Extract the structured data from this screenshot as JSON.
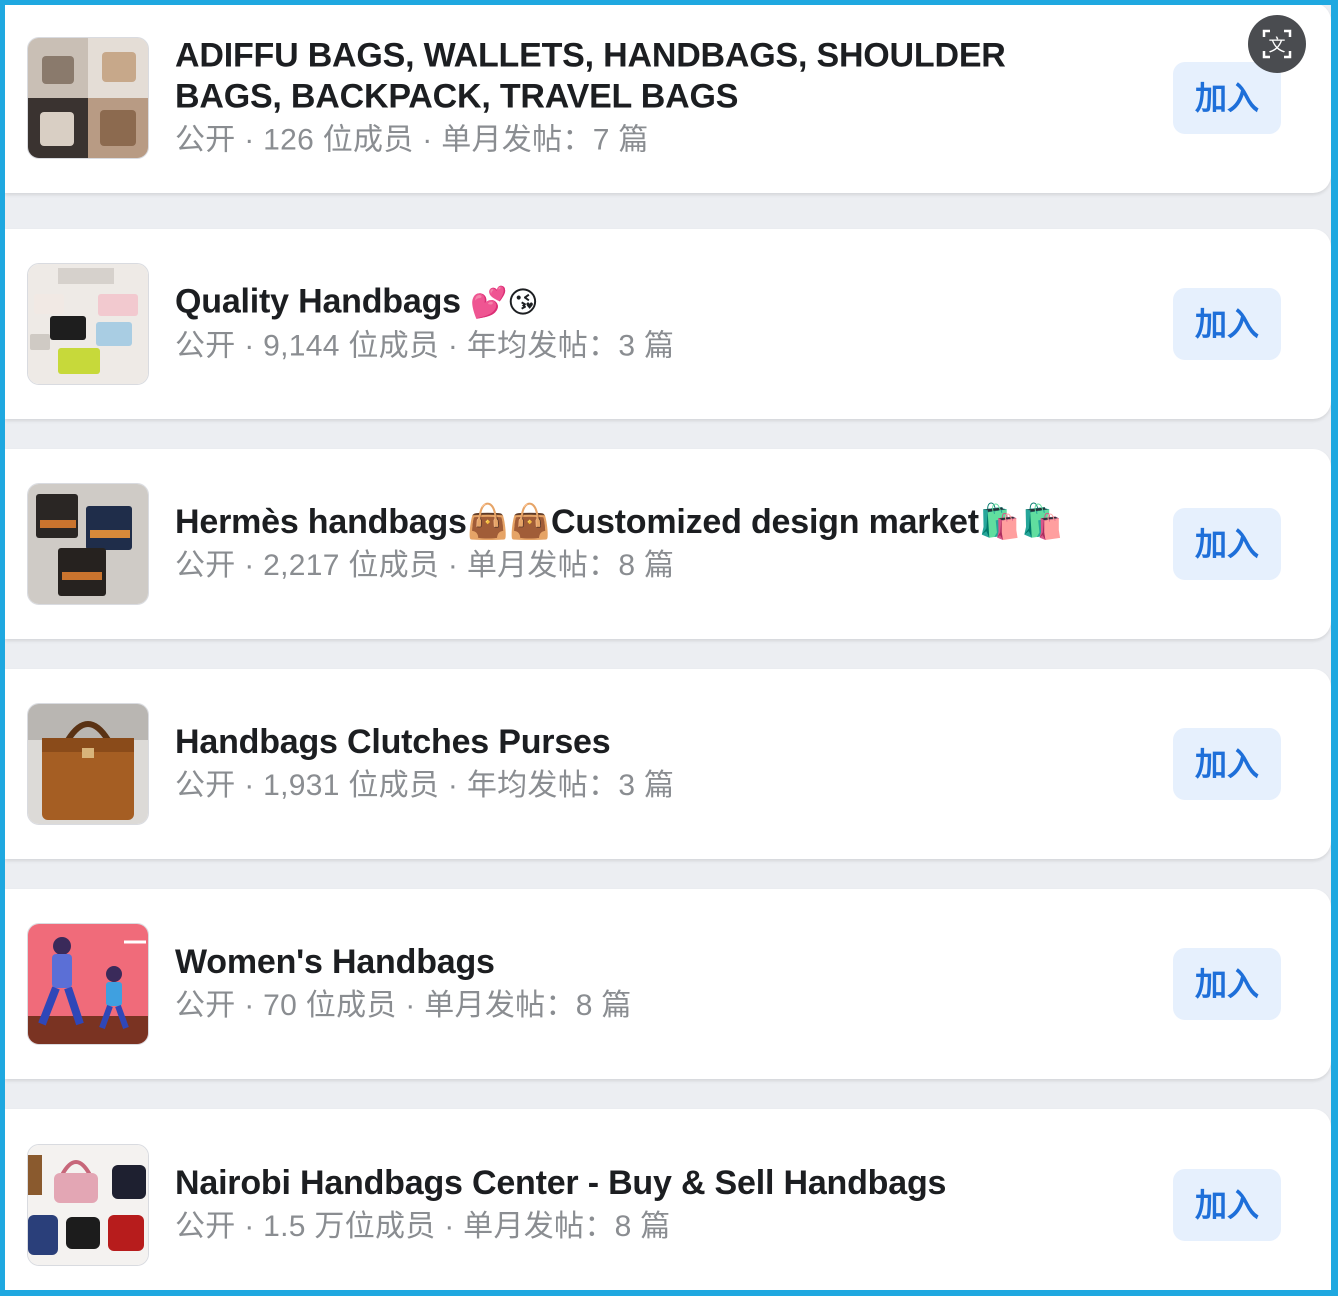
{
  "translate_button": {
    "icon": "translate-icon",
    "glyph": "文"
  },
  "groups": [
    {
      "title": "ADIFFU BAGS, WALLETS, HANDBAGS, SHOULDER BAGS, BACKPACK, TRAVEL BAGS",
      "emoji": "",
      "meta": "公开 · 126 位成员 · 单月发帖：7 篇",
      "join_label": "加入"
    },
    {
      "title": "Quality Handbags ",
      "emoji": "💕😘",
      "meta": "公开 · 9,144 位成员 · 年均发帖：3 篇",
      "join_label": "加入"
    },
    {
      "title": "Hermès handbags👜👜Customized design market🛍️🛍️",
      "emoji": "",
      "meta": "公开 · 2,217 位成员 · 单月发帖：8 篇",
      "join_label": "加入"
    },
    {
      "title": "Handbags Clutches Purses",
      "emoji": "",
      "meta": "公开 · 1,931 位成员 · 年均发帖：3 篇",
      "join_label": "加入"
    },
    {
      "title": "Women's Handbags",
      "emoji": "",
      "meta": "公开 · 70 位成员 · 单月发帖：8 篇",
      "join_label": "加入"
    },
    {
      "title": "Nairobi Handbags Center - Buy & Sell Handbags",
      "emoji": "",
      "meta": "公开 · 1.5 万位成员 · 单月发帖：8 篇",
      "join_label": "加入"
    }
  ],
  "colors": {
    "border": "#1fa8e0",
    "join_bg": "#e6f0fd",
    "join_text": "#1e6fd9",
    "meta_text": "#8a8d91"
  }
}
